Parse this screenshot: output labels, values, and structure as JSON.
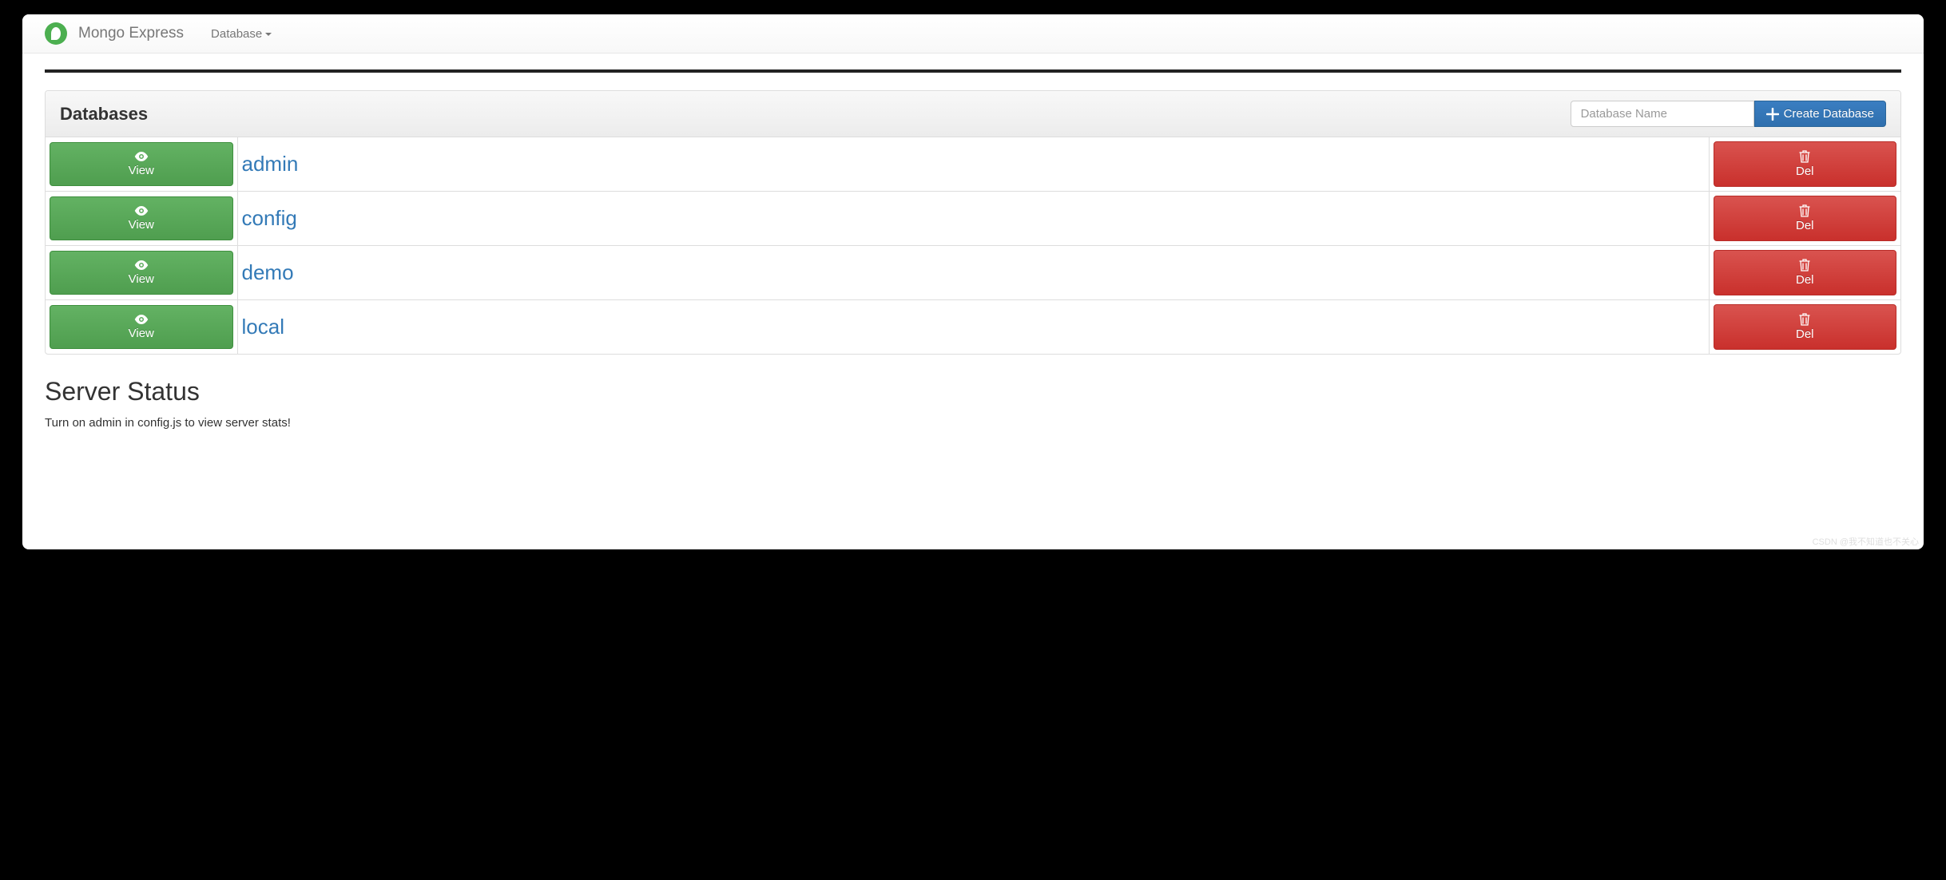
{
  "navbar": {
    "brand": "Mongo Express",
    "menu_label": "Database"
  },
  "panel": {
    "title": "Databases",
    "input_placeholder": "Database Name",
    "create_button": "Create Database"
  },
  "buttons": {
    "view": "View",
    "del": "Del"
  },
  "databases": [
    {
      "name": "admin"
    },
    {
      "name": "config"
    },
    {
      "name": "demo"
    },
    {
      "name": "local"
    }
  ],
  "status": {
    "title": "Server Status",
    "message": "Turn on admin in config.js to view server stats!"
  },
  "watermark": "CSDN @我不知道也不关心"
}
